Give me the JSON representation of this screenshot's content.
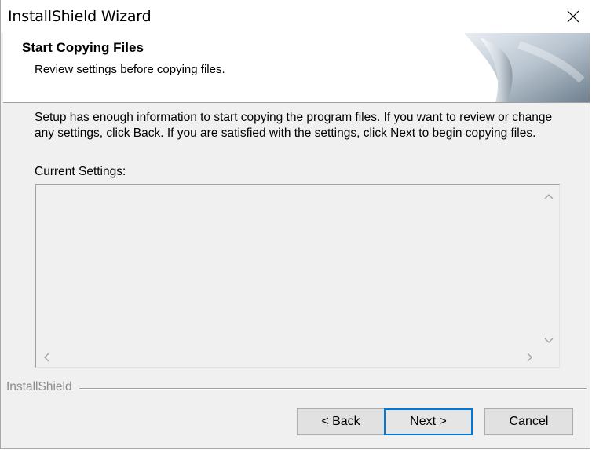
{
  "window": {
    "title": "InstallShield Wizard",
    "close_icon": "close-icon"
  },
  "header": {
    "title": "Start Copying Files",
    "subtitle": "Review settings before copying files."
  },
  "main": {
    "description": "Setup has enough information to start copying the program files.  If you want to review or change any settings, click Back.  If you are satisfied with the settings, click Next to begin copying files.",
    "settings_label": "Current Settings:",
    "settings_value": ""
  },
  "footer": {
    "brand": "InstallShield",
    "back_label": "< Back",
    "next_label": "Next >",
    "cancel_label": "Cancel"
  },
  "colors": {
    "window_bg": "#f0f0f0",
    "header_bg": "#ffffff",
    "default_button_border": "#0078d7",
    "brand_text": "#8c8c8c"
  }
}
